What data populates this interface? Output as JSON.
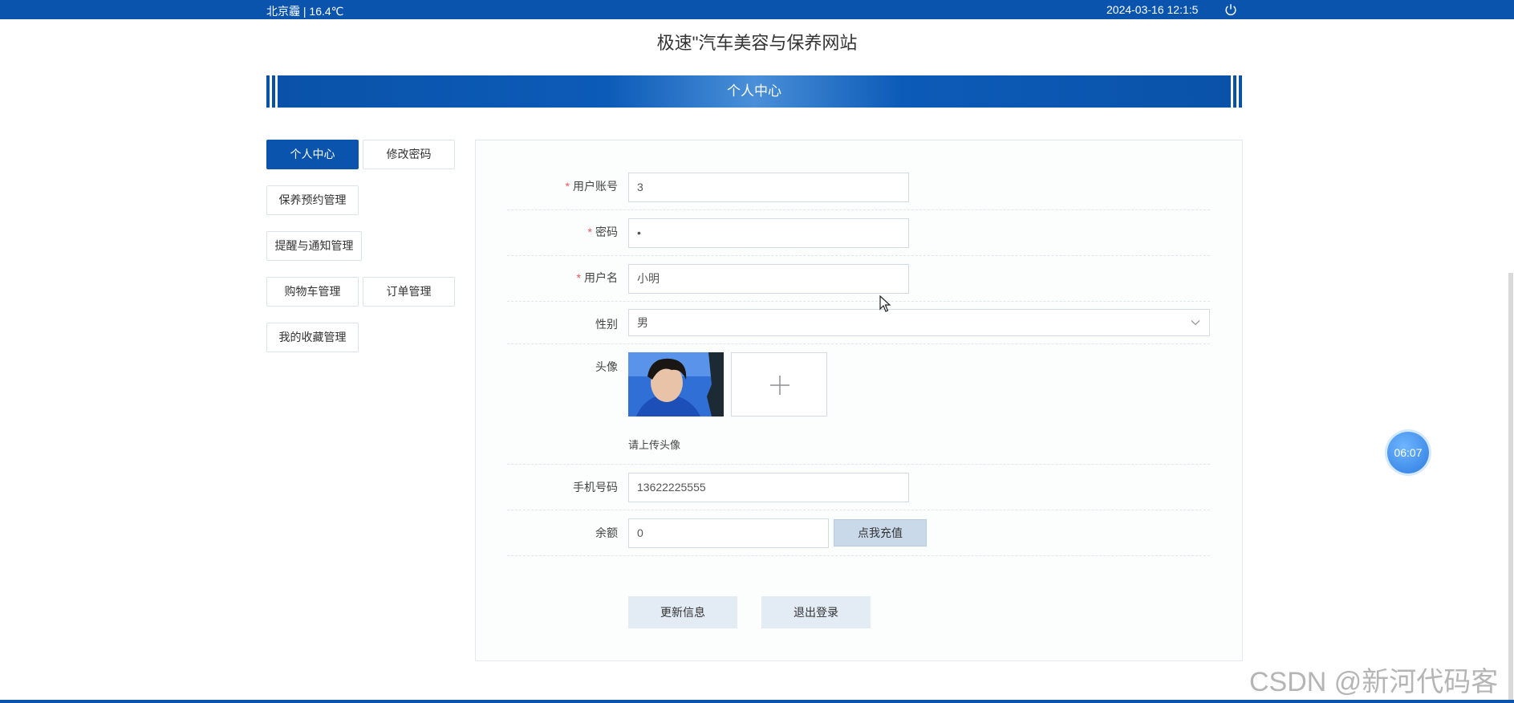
{
  "topbar": {
    "weather": "北京霾 | 16.4℃",
    "datetime": "2024-03-16   12:1:5",
    "power_icon": "power-icon",
    "bg_color": "#0a54ad"
  },
  "site_title": "极速\"汽车美容与保养网站",
  "section_title": "个人中心",
  "menu": {
    "personal_center": "个人中心",
    "change_password": "修改密码",
    "maintenance_booking": "保养预约管理",
    "reminders": "提醒与通知管理",
    "cart": "购物车管理",
    "orders": "订单管理",
    "favorites": "我的收藏管理"
  },
  "form": {
    "account_label": "用户账号",
    "account_value": "3",
    "password_label": "密码",
    "password_value": "•",
    "username_label": "用户名",
    "username_value": "小明",
    "gender_label": "性别",
    "gender_value": "男",
    "avatar_label": "头像",
    "upload_hint": "请上传头像",
    "phone_label": "手机号码",
    "phone_value": "13622225555",
    "balance_label": "余额",
    "balance_value": "0",
    "recharge_button": "点我充值",
    "required_mark": "*"
  },
  "actions": {
    "update": "更新信息",
    "logout": "退出登录"
  },
  "timer": "06:07",
  "watermark": "CSDN @新河代码客"
}
